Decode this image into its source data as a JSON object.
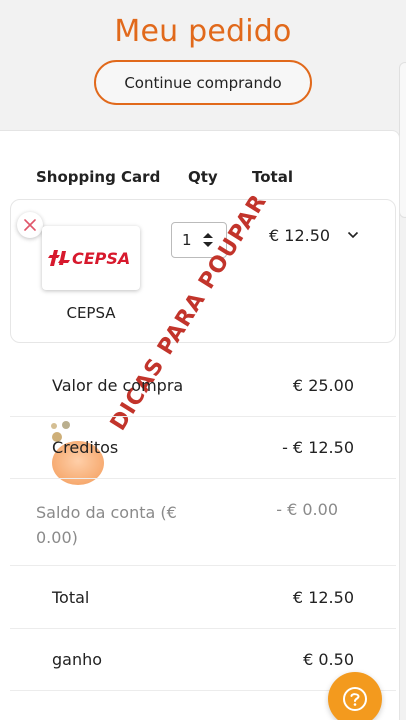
{
  "header": {
    "title": "Meu pedido",
    "continue_label": "Continue comprando"
  },
  "cart": {
    "columns": {
      "shopping_card": "Shopping Card",
      "qty": "Qty",
      "total": "Total"
    },
    "item": {
      "logo_text": "CEPSA",
      "name": "CEPSA",
      "qty": "1",
      "total": "€ 12.50"
    }
  },
  "summary": {
    "purchase_label": "Valor de compra",
    "purchase_value": "€ 25.00",
    "credits_label": "Creditos",
    "credits_value": "- € 12.50",
    "balance_label_1": "Saldo da conta (€",
    "balance_label_2": "0.00)",
    "balance_value": "- € 0.00",
    "total_label": "Total",
    "total_value": "€ 12.50",
    "gain_label": "ganho",
    "gain_value": "€ 0.50"
  },
  "watermark_text": "DICAS PARA POUPAR",
  "colors": {
    "accent": "#e1691b",
    "brand_red": "#d7192d",
    "help": "#f39a1e"
  },
  "icons": {
    "remove": "close-icon",
    "qty": "stepper-arrows-icon",
    "expand": "chevron-down-icon",
    "help": "question-icon"
  }
}
